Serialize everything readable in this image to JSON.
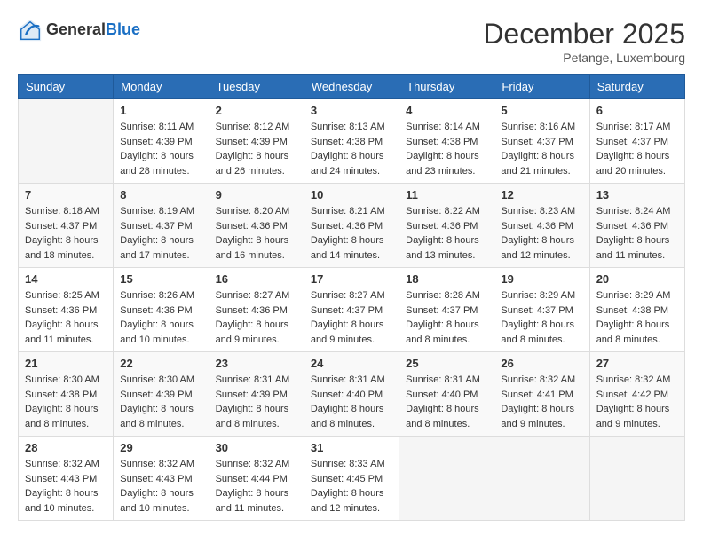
{
  "header": {
    "logo_general": "General",
    "logo_blue": "Blue",
    "month_title": "December 2025",
    "location": "Petange, Luxembourg"
  },
  "days_of_week": [
    "Sunday",
    "Monday",
    "Tuesday",
    "Wednesday",
    "Thursday",
    "Friday",
    "Saturday"
  ],
  "weeks": [
    [
      {
        "day": "",
        "sunrise": "",
        "sunset": "",
        "daylight": ""
      },
      {
        "day": "1",
        "sunrise": "8:11 AM",
        "sunset": "4:39 PM",
        "daylight": "8 hours and 28 minutes."
      },
      {
        "day": "2",
        "sunrise": "8:12 AM",
        "sunset": "4:39 PM",
        "daylight": "8 hours and 26 minutes."
      },
      {
        "day": "3",
        "sunrise": "8:13 AM",
        "sunset": "4:38 PM",
        "daylight": "8 hours and 24 minutes."
      },
      {
        "day": "4",
        "sunrise": "8:14 AM",
        "sunset": "4:38 PM",
        "daylight": "8 hours and 23 minutes."
      },
      {
        "day": "5",
        "sunrise": "8:16 AM",
        "sunset": "4:37 PM",
        "daylight": "8 hours and 21 minutes."
      },
      {
        "day": "6",
        "sunrise": "8:17 AM",
        "sunset": "4:37 PM",
        "daylight": "8 hours and 20 minutes."
      }
    ],
    [
      {
        "day": "7",
        "sunrise": "8:18 AM",
        "sunset": "4:37 PM",
        "daylight": "8 hours and 18 minutes."
      },
      {
        "day": "8",
        "sunrise": "8:19 AM",
        "sunset": "4:37 PM",
        "daylight": "8 hours and 17 minutes."
      },
      {
        "day": "9",
        "sunrise": "8:20 AM",
        "sunset": "4:36 PM",
        "daylight": "8 hours and 16 minutes."
      },
      {
        "day": "10",
        "sunrise": "8:21 AM",
        "sunset": "4:36 PM",
        "daylight": "8 hours and 14 minutes."
      },
      {
        "day": "11",
        "sunrise": "8:22 AM",
        "sunset": "4:36 PM",
        "daylight": "8 hours and 13 minutes."
      },
      {
        "day": "12",
        "sunrise": "8:23 AM",
        "sunset": "4:36 PM",
        "daylight": "8 hours and 12 minutes."
      },
      {
        "day": "13",
        "sunrise": "8:24 AM",
        "sunset": "4:36 PM",
        "daylight": "8 hours and 11 minutes."
      }
    ],
    [
      {
        "day": "14",
        "sunrise": "8:25 AM",
        "sunset": "4:36 PM",
        "daylight": "8 hours and 11 minutes."
      },
      {
        "day": "15",
        "sunrise": "8:26 AM",
        "sunset": "4:36 PM",
        "daylight": "8 hours and 10 minutes."
      },
      {
        "day": "16",
        "sunrise": "8:27 AM",
        "sunset": "4:36 PM",
        "daylight": "8 hours and 9 minutes."
      },
      {
        "day": "17",
        "sunrise": "8:27 AM",
        "sunset": "4:37 PM",
        "daylight": "8 hours and 9 minutes."
      },
      {
        "day": "18",
        "sunrise": "8:28 AM",
        "sunset": "4:37 PM",
        "daylight": "8 hours and 8 minutes."
      },
      {
        "day": "19",
        "sunrise": "8:29 AM",
        "sunset": "4:37 PM",
        "daylight": "8 hours and 8 minutes."
      },
      {
        "day": "20",
        "sunrise": "8:29 AM",
        "sunset": "4:38 PM",
        "daylight": "8 hours and 8 minutes."
      }
    ],
    [
      {
        "day": "21",
        "sunrise": "8:30 AM",
        "sunset": "4:38 PM",
        "daylight": "8 hours and 8 minutes."
      },
      {
        "day": "22",
        "sunrise": "8:30 AM",
        "sunset": "4:39 PM",
        "daylight": "8 hours and 8 minutes."
      },
      {
        "day": "23",
        "sunrise": "8:31 AM",
        "sunset": "4:39 PM",
        "daylight": "8 hours and 8 minutes."
      },
      {
        "day": "24",
        "sunrise": "8:31 AM",
        "sunset": "4:40 PM",
        "daylight": "8 hours and 8 minutes."
      },
      {
        "day": "25",
        "sunrise": "8:31 AM",
        "sunset": "4:40 PM",
        "daylight": "8 hours and 8 minutes."
      },
      {
        "day": "26",
        "sunrise": "8:32 AM",
        "sunset": "4:41 PM",
        "daylight": "8 hours and 9 minutes."
      },
      {
        "day": "27",
        "sunrise": "8:32 AM",
        "sunset": "4:42 PM",
        "daylight": "8 hours and 9 minutes."
      }
    ],
    [
      {
        "day": "28",
        "sunrise": "8:32 AM",
        "sunset": "4:43 PM",
        "daylight": "8 hours and 10 minutes."
      },
      {
        "day": "29",
        "sunrise": "8:32 AM",
        "sunset": "4:43 PM",
        "daylight": "8 hours and 10 minutes."
      },
      {
        "day": "30",
        "sunrise": "8:32 AM",
        "sunset": "4:44 PM",
        "daylight": "8 hours and 11 minutes."
      },
      {
        "day": "31",
        "sunrise": "8:33 AM",
        "sunset": "4:45 PM",
        "daylight": "8 hours and 12 minutes."
      },
      {
        "day": "",
        "sunrise": "",
        "sunset": "",
        "daylight": ""
      },
      {
        "day": "",
        "sunrise": "",
        "sunset": "",
        "daylight": ""
      },
      {
        "day": "",
        "sunrise": "",
        "sunset": "",
        "daylight": ""
      }
    ]
  ]
}
